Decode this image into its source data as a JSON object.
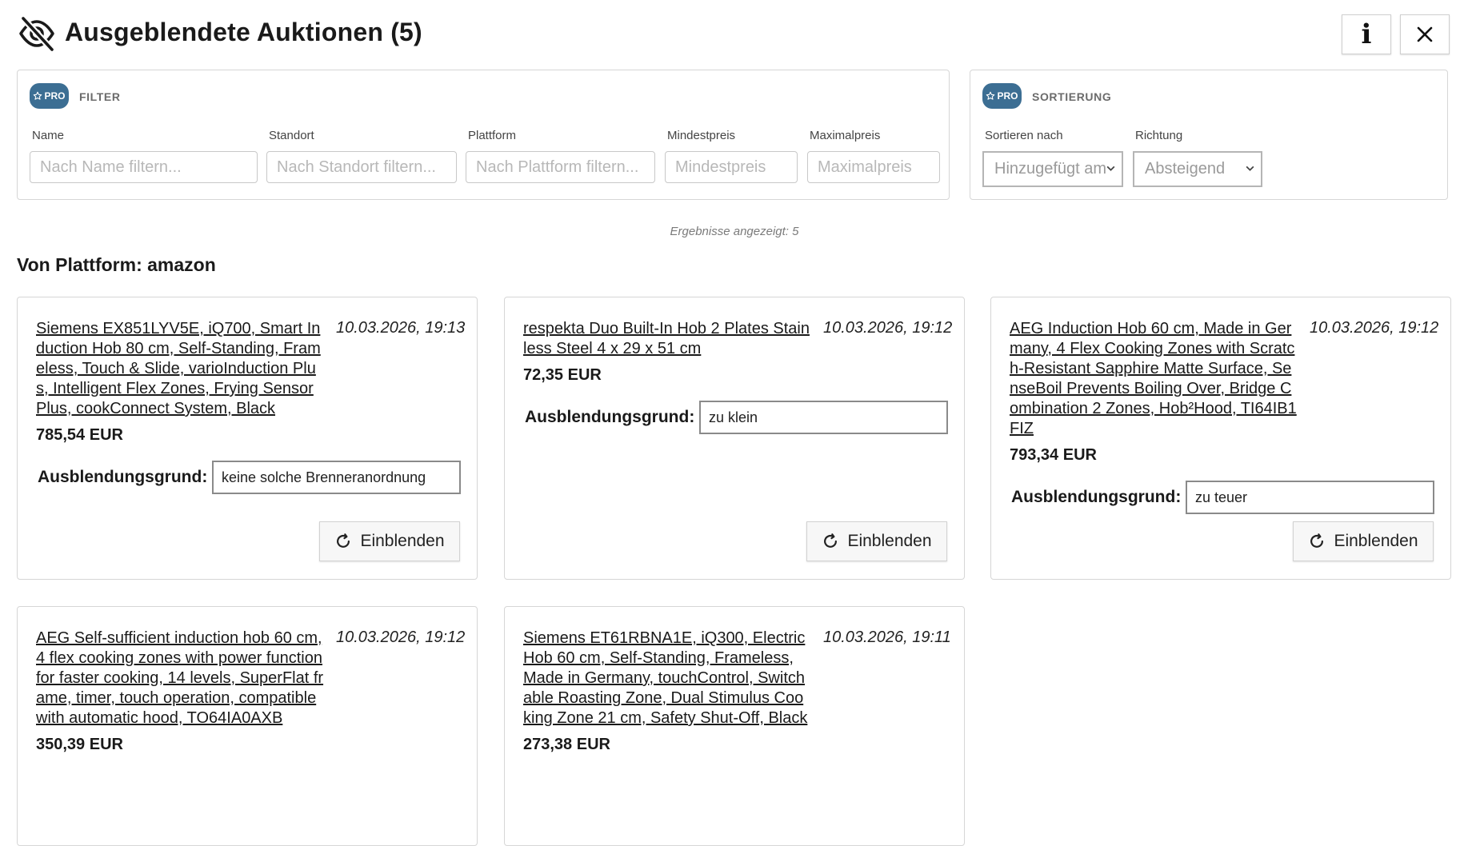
{
  "header": {
    "title": "Ausgeblendete Auktionen (5)",
    "info_label": "i"
  },
  "filter": {
    "badge": "PRO",
    "title": "FILTER",
    "fields": [
      {
        "label": "Name",
        "placeholder": "Nach Name filtern..."
      },
      {
        "label": "Standort",
        "placeholder": "Nach Standort filtern..."
      },
      {
        "label": "Plattform",
        "placeholder": "Nach Plattform filtern..."
      },
      {
        "label": "Mindestpreis",
        "placeholder": "Mindestpreis"
      },
      {
        "label": "Maximalpreis",
        "placeholder": "Maximalpreis"
      }
    ]
  },
  "sort": {
    "badge": "PRO",
    "title": "SORTIERUNG",
    "sort_by": {
      "label": "Sortieren nach",
      "value": "Hinzugefügt am"
    },
    "direction": {
      "label": "Richtung",
      "value": "Absteigend"
    }
  },
  "results_text": "Ergebnisse angezeigt: 5",
  "section_title": "Von Plattform: amazon",
  "reason_label": "Ausblendungsgrund:",
  "show_label": "Einblenden",
  "cards": [
    {
      "title": "Siemens EX851LYV5E, iQ700, Smart Induction Hob 80 cm, Self-Standing, Frameless, Touch & Slide, varioInduction Plus, Intelligent Flex Zones, Frying Sensor Plus, cookConnect System, Black",
      "date": "10.03.2026, 19:13",
      "price": "785,54 EUR",
      "reason": "keine solche Brenneranordnung"
    },
    {
      "title": "respekta Duo Built-In Hob 2 Plates Stainless Steel 4 x 29 x 51 cm",
      "date": "10.03.2026, 19:12",
      "price": "72,35 EUR",
      "reason": "zu klein"
    },
    {
      "title": "AEG Induction Hob 60 cm, Made in Germany, 4 Flex Cooking Zones with Scratch-Resistant Sapphire Matte Surface, SenseBoil Prevents Boiling Over, Bridge Combination 2 Zones, Hob²Hood, TI64IB1FIZ",
      "date": "10.03.2026, 19:12",
      "price": "793,34 EUR",
      "reason": "zu teuer"
    },
    {
      "title": "AEG Self-sufficient induction hob 60 cm, 4 flex cooking zones with power function for faster cooking, 14 levels, SuperFlat frame, timer, touch operation, compatible with automatic hood, TO64IA0AXB",
      "date": "10.03.2026, 19:12",
      "price": "350,39 EUR"
    },
    {
      "title": "Siemens ET61RBNA1E, iQ300, Electric Hob 60 cm, Self-Standing, Frameless, Made in Germany, touchControl, Switchable Roasting Zone, Dual Stimulus Cooking Zone 21 cm, Safety Shut-Off, Black",
      "date": "10.03.2026, 19:11",
      "price": "273,38 EUR"
    }
  ]
}
